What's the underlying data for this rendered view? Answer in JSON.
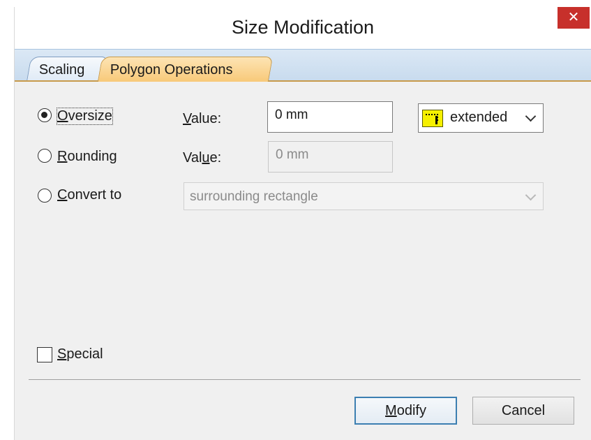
{
  "window": {
    "title": "Size Modification",
    "close_glyph": "✕"
  },
  "tabs": [
    {
      "label": "Scaling",
      "active": false
    },
    {
      "label": "Polygon Operations",
      "active": true
    }
  ],
  "oversize": {
    "label_mnemonic": "O",
    "label_rest": "versize",
    "selected": true,
    "value_label_mnemonic": "V",
    "value_label_rest": "alue:",
    "value": "0 mm"
  },
  "rounding": {
    "label_mnemonic": "R",
    "label_rest": "ounding",
    "selected": false,
    "value_label_pre": "Val",
    "value_label_mnemonic": "u",
    "value_label_post": "e:",
    "value": "0 mm"
  },
  "convert": {
    "label_mnemonic": "C",
    "label_rest": "onvert to",
    "selected": false,
    "option": "surrounding rectangle"
  },
  "mode_dropdown": {
    "selected": "extended",
    "icon": "extended-corner-icon"
  },
  "special": {
    "label_mnemonic": "S",
    "label_rest": "pecial",
    "checked": false
  },
  "buttons": {
    "modify_mnemonic": "M",
    "modify_rest": "odify",
    "cancel": "Cancel"
  },
  "colors": {
    "close": "#c7302b",
    "active_tab": "#f8c979",
    "default_button_border": "#3c7fb1"
  }
}
